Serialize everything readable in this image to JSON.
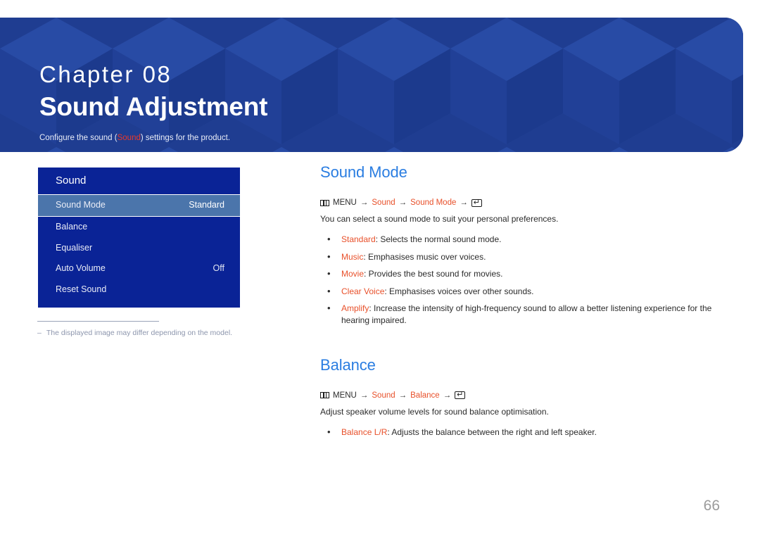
{
  "banner": {
    "chapter_label": "Chapter 08",
    "chapter_title": "Sound Adjustment",
    "subtitle_before": "Configure the sound (",
    "subtitle_highlight": "Sound",
    "subtitle_after": ") settings for the product.",
    "bg_color": "#1f3d91",
    "highlight_color": "#e8392b"
  },
  "osd": {
    "title": "Sound",
    "panel_color": "#0a2396",
    "selected_color": "#4b75ab",
    "rows": [
      {
        "label": "Sound Mode",
        "value": "Standard",
        "selected": true
      },
      {
        "label": "Balance",
        "value": "",
        "selected": false
      },
      {
        "label": "Equaliser",
        "value": "",
        "selected": false
      },
      {
        "label": "Auto Volume",
        "value": "Off",
        "selected": false
      },
      {
        "label": "Reset Sound",
        "value": "",
        "selected": false
      }
    ]
  },
  "footnote": {
    "dash": "–",
    "text": "The displayed image may differ depending on the model."
  },
  "sections": [
    {
      "title": "Sound Mode",
      "path": {
        "menu_icon": "menu-icon",
        "menu_label": "MENU",
        "arrow": "→",
        "steps": [
          "Sound",
          "Sound Mode"
        ],
        "enter_icon": "enter-key-icon"
      },
      "lead": "You can select a sound mode to suit your personal preferences.",
      "bullets": [
        {
          "term": "Standard",
          "desc": ": Selects the normal sound mode."
        },
        {
          "term": "Music",
          "desc": ": Emphasises music over voices."
        },
        {
          "term": "Movie",
          "desc": ": Provides the best sound for movies."
        },
        {
          "term": "Clear Voice",
          "desc": ": Emphasises voices over other sounds."
        },
        {
          "term": "Amplify",
          "desc": ": Increase the intensity of high-frequency sound to allow a better listening experience for the hearing impaired."
        }
      ]
    },
    {
      "title": "Balance",
      "path": {
        "menu_icon": "menu-icon",
        "menu_label": "MENU",
        "arrow": "→",
        "steps": [
          "Sound",
          "Balance"
        ],
        "enter_icon": "enter-key-icon"
      },
      "lead": "Adjust speaker volume levels for sound balance optimisation.",
      "bullets": [
        {
          "term": "Balance L/R",
          "desc": ": Adjusts the balance between the right and left speaker."
        }
      ]
    }
  ],
  "page_number": "66",
  "colors": {
    "section_title": "#2a7de1",
    "term": "#e8502a",
    "body": "#2b2b2b"
  }
}
